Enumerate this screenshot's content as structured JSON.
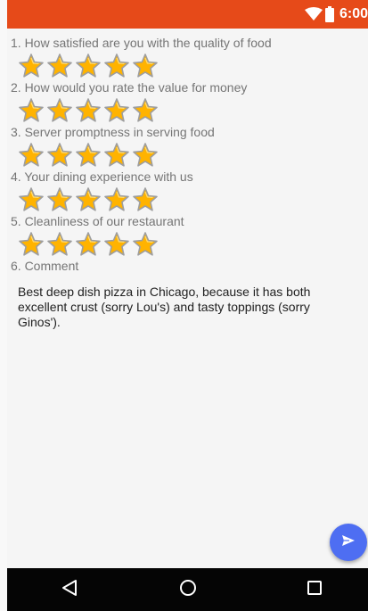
{
  "status_bar": {
    "time": "6:00",
    "icons": [
      "wifi-icon",
      "battery-icon"
    ],
    "color": "#e64a19"
  },
  "survey": {
    "questions": [
      {
        "label": "1. How satisfied are you with the quality of food",
        "rating": 5,
        "max": 5
      },
      {
        "label": "2. How would you rate the value for money",
        "rating": 5,
        "max": 5
      },
      {
        "label": "3. Server promptness in serving food",
        "rating": 5,
        "max": 5
      },
      {
        "label": "4. Your dining experience with us",
        "rating": 5,
        "max": 5
      },
      {
        "label": "5. Cleanliness of our restaurant",
        "rating": 5,
        "max": 5
      }
    ],
    "comment_label": "6. Comment",
    "comment_value": "Best deep dish pizza in Chicago, because it has both excellent crust (sorry Lou's) and tasty toppings (sorry Ginos')."
  },
  "fab": {
    "icon": "send-icon",
    "color": "#4e6ef2"
  },
  "nav_bar": {
    "icons": [
      "back-icon",
      "home-icon",
      "recents-icon"
    ]
  },
  "colors": {
    "star": "#ffb300",
    "star_outline": "#9e9e9e"
  }
}
